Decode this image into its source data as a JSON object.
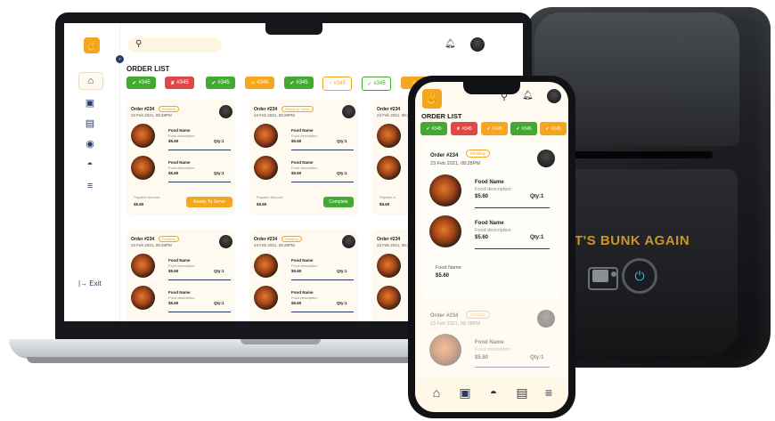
{
  "printer": {
    "brand_text": "T'S BUNK AGAIN",
    "power_icon": "power-icon"
  },
  "colors": {
    "accent_orange": "#f4a620",
    "accept_green": "#43a932",
    "reject_red": "#e04848",
    "navy": "#2b3a6a",
    "cream": "#fffaf0"
  },
  "laptop": {
    "sidebar": {
      "logo_icon": "restaurant-logo-icon",
      "exit_label": "|→ Exit",
      "nav_icons": [
        "home-icon",
        "bag-icon",
        "menu-icon",
        "dish-icon",
        "chef-icon",
        "filter-icon"
      ]
    },
    "header": {
      "search_icon": "search-icon",
      "bell_icon": "bell-icon",
      "title": "ORDER LIST"
    },
    "chips": [
      {
        "label": "#345",
        "status": "accepted"
      },
      {
        "label": "#345",
        "status": "rejected"
      },
      {
        "label": "#345",
        "status": "accepted"
      },
      {
        "label": "#345",
        "status": "serving"
      },
      {
        "label": "#345",
        "status": "accepted"
      },
      {
        "label": "#345",
        "status": "pending"
      },
      {
        "label": "#345",
        "status": "done"
      },
      {
        "label": "",
        "status": "serving"
      }
    ],
    "cards_row1": [
      {
        "order": "Order #234",
        "badge": "Pending",
        "date": "23 Feb 2021, 08:28PM",
        "items": [
          {
            "name": "Food Name",
            "desc": "Food description",
            "price": "$5.60",
            "qty": "Qty:1"
          },
          {
            "name": "Food Name",
            "desc": "Food description",
            "price": "$5.60",
            "qty": "Qty:1"
          }
        ],
        "payable_label": "Payable Amount",
        "payable_value": "$5.60",
        "action": "Ready To Serve"
      },
      {
        "order": "Order #234",
        "badge": "Ready to Serve",
        "date": "23 Feb 2021, 08:28PM",
        "items": [
          {
            "name": "Food Name",
            "desc": "Food description",
            "price": "$5.60",
            "qty": "Qty:1"
          },
          {
            "name": "Food Name",
            "desc": "Food description",
            "price": "$5.60",
            "qty": "Qty:1"
          }
        ],
        "payable_label": "Payable Amount",
        "payable_value": "$5.60",
        "action": "Complete"
      },
      {
        "order": "Order #234",
        "badge": "",
        "date": "23 Feb 2021, 08:2",
        "items": [
          {
            "name": "",
            "desc": "",
            "price": "",
            "qty": ""
          },
          {
            "name": "",
            "desc": "",
            "price": "",
            "qty": ""
          }
        ],
        "payable_label": "Payable A",
        "payable_value": "$5.60",
        "action": ""
      }
    ],
    "cards_row2": [
      {
        "order": "Order #234",
        "badge": "Pending",
        "date": "23 Feb 2021, 08:28PM",
        "items": [
          {
            "name": "Food Name",
            "desc": "Food description",
            "price": "$5.60",
            "qty": "Qty:1"
          },
          {
            "name": "Food Name",
            "desc": "Food description",
            "price": "$5.60",
            "qty": "Qty:1"
          }
        ]
      },
      {
        "order": "Order #234",
        "badge": "Pending",
        "date": "23 Feb 2021, 08:28PM",
        "items": [
          {
            "name": "Food Name",
            "desc": "Food description",
            "price": "$5.60",
            "qty": "Qty:1"
          },
          {
            "name": "Food Name",
            "desc": "Food description",
            "price": "$5.60",
            "qty": "Qty:1"
          }
        ]
      },
      {
        "order": "Order #234",
        "badge": "",
        "date": "23 Feb 2021, 08:2",
        "items": [
          {
            "name": "",
            "desc": "",
            "price": "",
            "qty": ""
          },
          {
            "name": "",
            "desc": "",
            "price": "",
            "qty": ""
          }
        ]
      }
    ]
  },
  "phone": {
    "title": "ORDER LIST",
    "chips": [
      {
        "label": "#345",
        "status": "accepted"
      },
      {
        "label": "#345",
        "status": "rejected"
      },
      {
        "label": "#345",
        "status": "serving"
      },
      {
        "label": "#345",
        "status": "accepted"
      },
      {
        "label": "#345",
        "status": "serving"
      }
    ],
    "card1": {
      "order": "Order #234",
      "badge": "Pending",
      "date": "23 Feb 2021, 08:28PM",
      "items": [
        {
          "name": "Food Name",
          "desc": "Food description",
          "price": "$5.60",
          "qty": "Qty:1"
        },
        {
          "name": "Food Name",
          "desc": "Food description",
          "price": "$5.60",
          "qty": "Qty:1"
        },
        {
          "name": "Food Name",
          "desc": "",
          "price": "$5.60",
          "qty": ""
        }
      ]
    },
    "card2": {
      "order": "Order #234",
      "badge": "Pending",
      "date": "23 Feb 2021, 08:28PM",
      "items": [
        {
          "name": "Food Name",
          "desc": "Food description",
          "price": "$5.60",
          "qty": "Qty:1"
        }
      ]
    },
    "nav_icons": [
      "home-icon",
      "bag-icon",
      "dish-icon",
      "menu-icon",
      "filter-icon"
    ]
  }
}
